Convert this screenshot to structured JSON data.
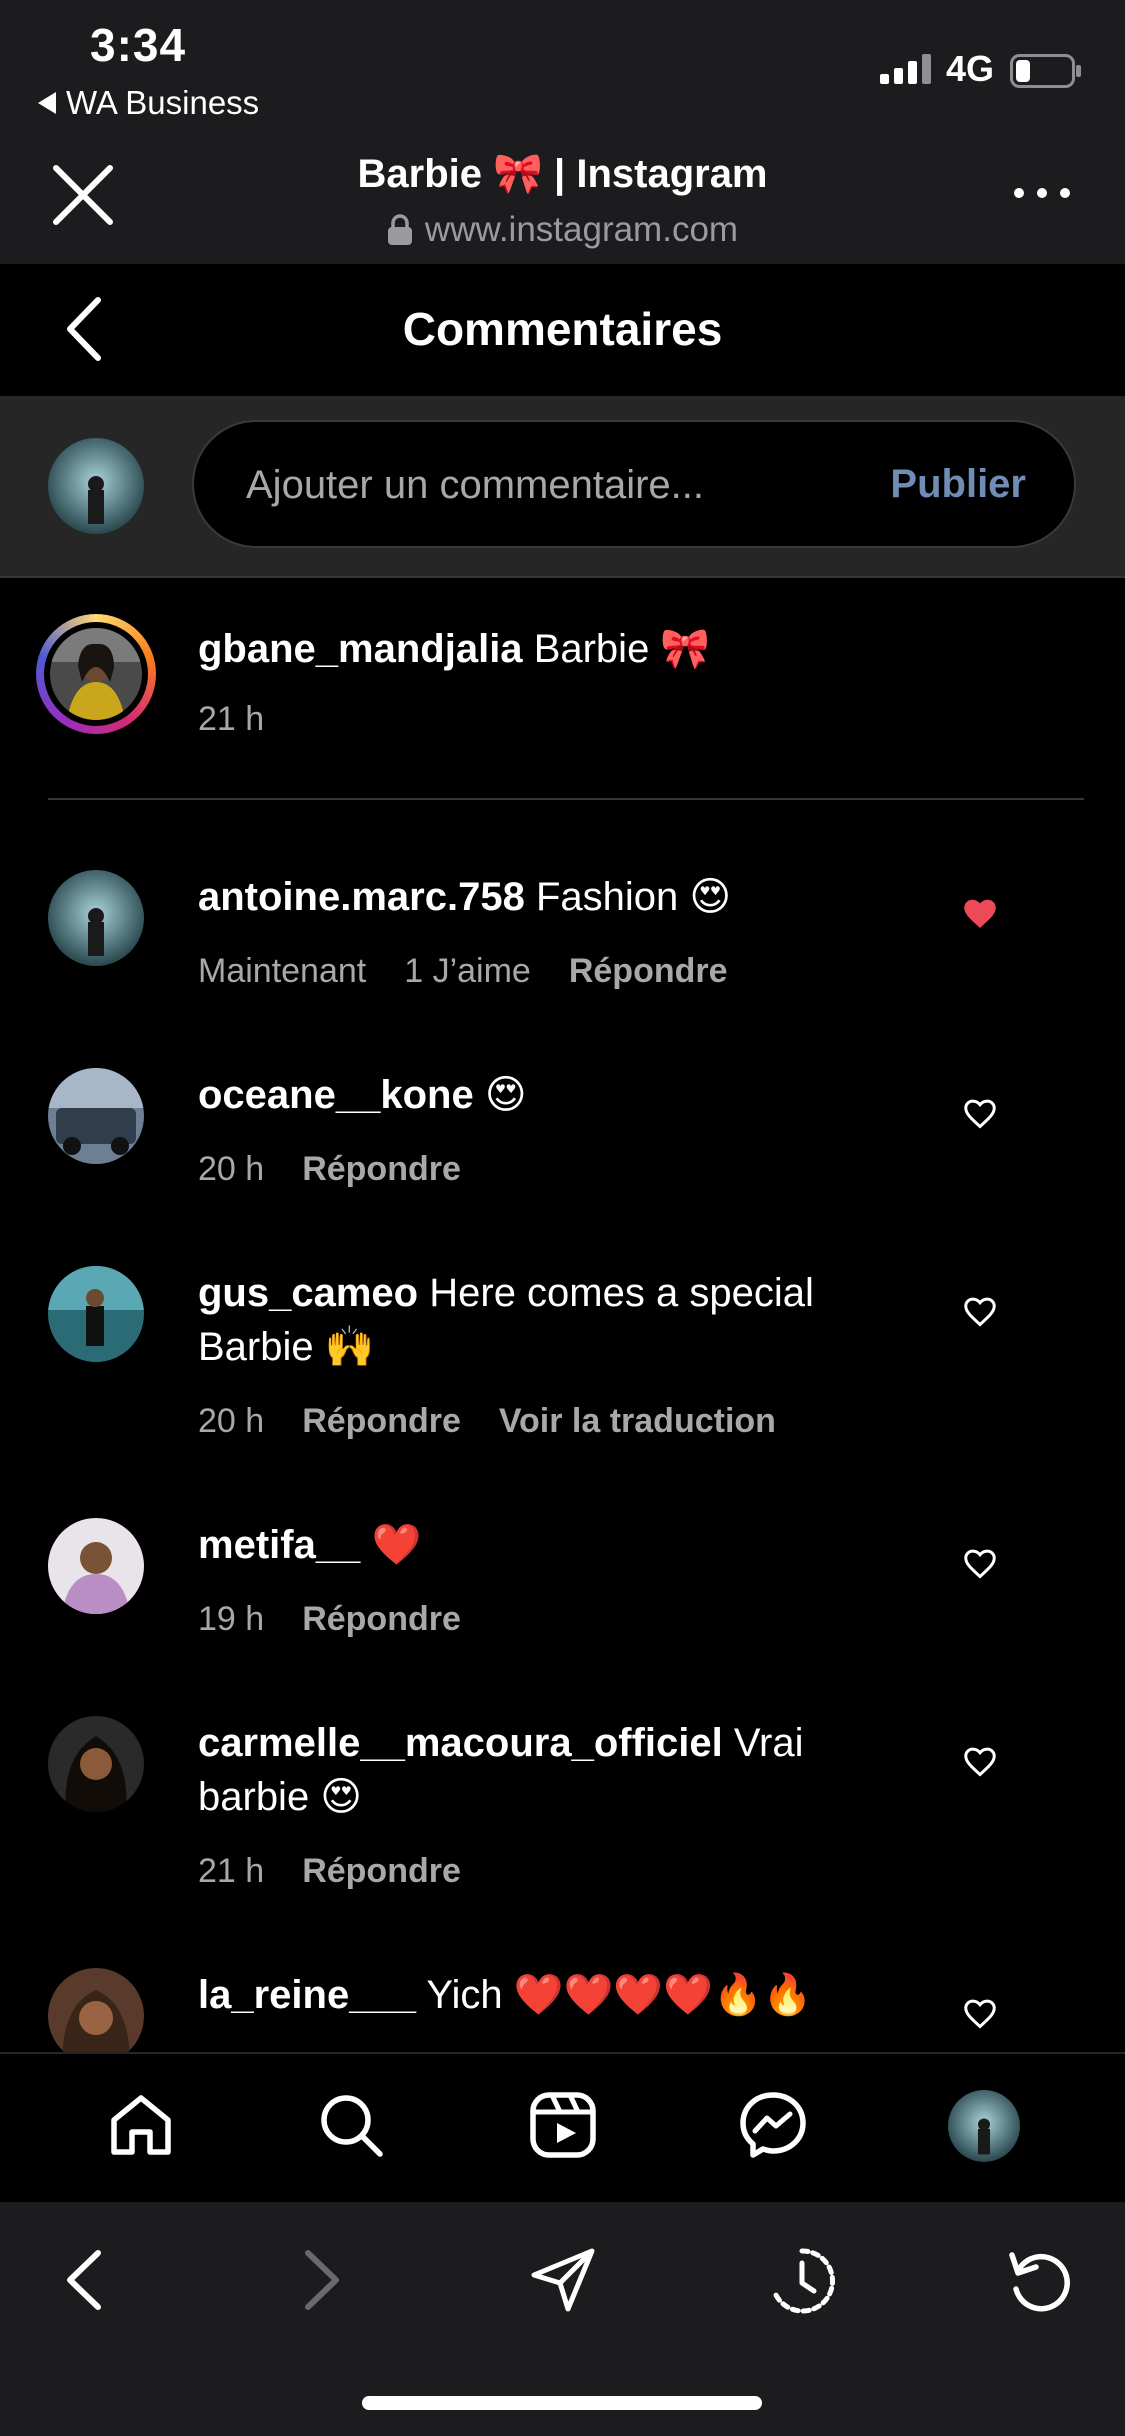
{
  "status_bar": {
    "time": "3:34",
    "back_app": "WA Business",
    "network": "4G"
  },
  "browser": {
    "title": "Barbie 🎀 | Instagram",
    "url": "www.instagram.com",
    "icons": [
      "close-icon",
      "lock-icon",
      "more-icon"
    ]
  },
  "header": {
    "title": "Commentaires"
  },
  "comment_input": {
    "placeholder": "Ajouter un commentaire...",
    "publish_label": "Publier"
  },
  "caption": {
    "username": "gbane_mandjalia",
    "text": "Barbie 🎀",
    "time": "21 h"
  },
  "comments": [
    {
      "username": "antoine.marc.758",
      "text": "Fashion 😍",
      "time": "Maintenant",
      "likes": "1 J’aime",
      "reply": "Répondre",
      "liked": true
    },
    {
      "username": "oceane__kone",
      "text": "😍",
      "time": "20 h",
      "reply": "Répondre",
      "liked": false
    },
    {
      "username": "gus_cameo",
      "text": "Here comes a special",
      "text2": "Barbie 🙌",
      "time": "20 h",
      "reply": "Répondre",
      "translate": "Voir la traduction",
      "liked": false
    },
    {
      "username": "metifa__",
      "text": "❤️",
      "time": "19 h",
      "reply": "Répondre",
      "liked": false
    },
    {
      "username": "carmelle__macoura_officiel",
      "text": "Vrai",
      "text2": "barbie 😍",
      "time": "21 h",
      "reply": "Répondre",
      "liked": false
    },
    {
      "username": "la_reine___",
      "text": "Yich ❤️❤️❤️❤️🔥🔥",
      "liked": false
    }
  ],
  "colors": {
    "liked_heart": "#ed4956",
    "publish": "#6f8db5",
    "secondary_text": "#a8a8a8",
    "bar_bg": "#1c1c1e"
  },
  "bottom_nav": [
    "home-icon",
    "search-icon",
    "reels-icon",
    "messenger-icon",
    "profile-avatar"
  ],
  "browser_nav": [
    "back-icon",
    "forward-icon",
    "share-icon",
    "history-icon",
    "reload-icon"
  ]
}
